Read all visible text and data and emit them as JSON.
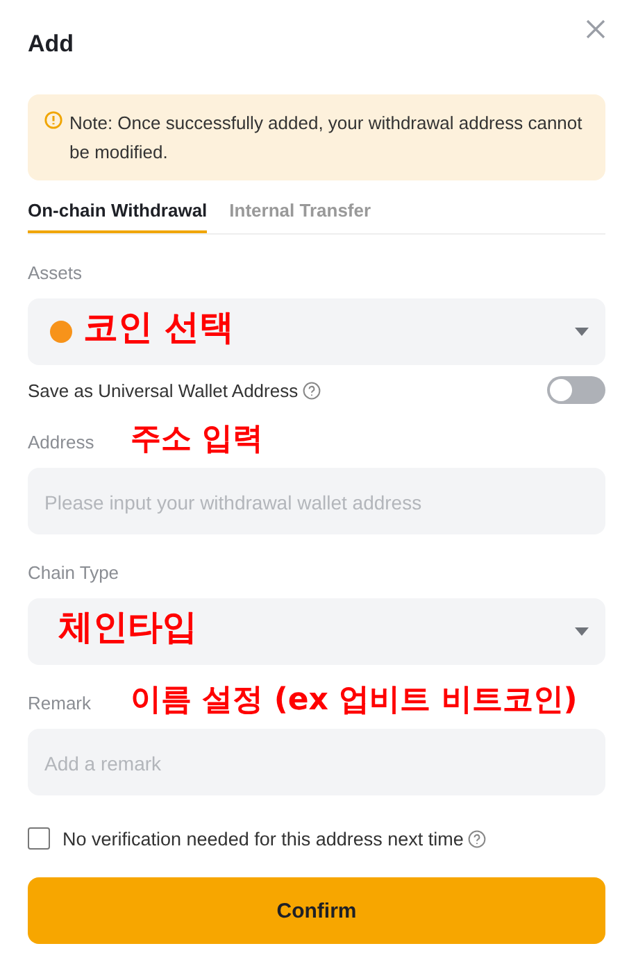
{
  "dialog": {
    "title": "Add"
  },
  "note": "Note: Once successfully added, your withdrawal address cannot be modified.",
  "tabs": [
    {
      "label": "On-chain Withdrawal",
      "selected": true
    },
    {
      "label": "Internal Transfer",
      "selected": false
    }
  ],
  "form": [
    {
      "kind": "asset-select",
      "label": "Assets",
      "annotation": "코인 선택"
    },
    {
      "kind": "toggle",
      "label": "Save as Universal Wallet Address",
      "on": false
    },
    {
      "kind": "input",
      "label": "Address",
      "placeholder": "Please input your withdrawal wallet address",
      "annotation": "주소 입력"
    },
    {
      "kind": "select",
      "label": "Chain Type",
      "annotation": "체인타입"
    },
    {
      "kind": "input",
      "label": "Remark",
      "placeholder": "Add a remark",
      "annotation": "이름 설정 (ex 업비트 비트코인)"
    }
  ],
  "verification": {
    "label": "No verification needed for this address next time",
    "checked": false
  },
  "confirm": "Confirm"
}
